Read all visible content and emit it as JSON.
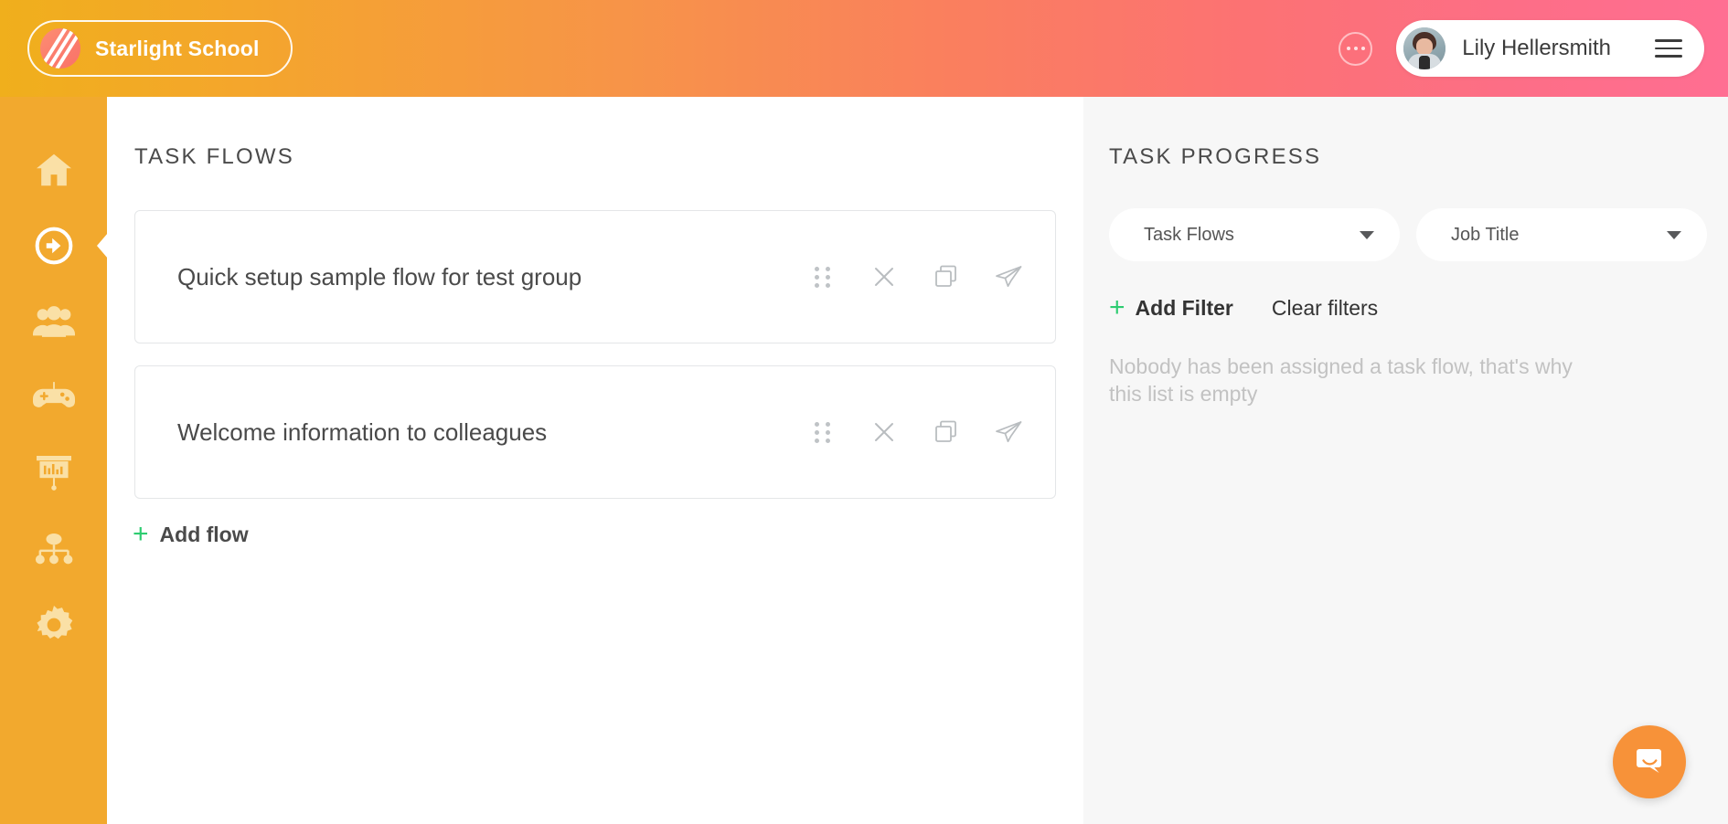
{
  "header": {
    "brand": {
      "name": "Starlight School",
      "logo_icon": "diagonal-stripes-logo"
    },
    "more_icon": "ellipsis-icon",
    "user": {
      "name": "Lily Hellersmith",
      "avatar_icon": "user-avatar-photo"
    },
    "menu_icon": "hamburger-menu-icon",
    "gradient_start": "#F0AF1C",
    "gradient_end": "#FF6E92"
  },
  "sidebar": {
    "background": "#F2A92E",
    "items": [
      {
        "name": "home",
        "icon": "home-icon",
        "active": false
      },
      {
        "name": "onboarding",
        "icon": "arrow-right-circle-icon",
        "active": true
      },
      {
        "name": "people",
        "icon": "people-group-icon",
        "active": false
      },
      {
        "name": "gamification",
        "icon": "gamepad-icon",
        "active": false
      },
      {
        "name": "presentations",
        "icon": "presentation-board-icon",
        "active": false
      },
      {
        "name": "org-chart",
        "icon": "hierarchy-icon",
        "active": false
      },
      {
        "name": "settings",
        "icon": "gear-icon",
        "active": false
      }
    ]
  },
  "main": {
    "title": "TASK FLOWS",
    "flows": [
      {
        "title": "Quick setup sample flow for test group",
        "actions": [
          "drag-handle-icon",
          "close-icon",
          "duplicate-icon",
          "send-icon"
        ]
      },
      {
        "title": "Welcome information to colleagues",
        "actions": [
          "drag-handle-icon",
          "close-icon",
          "duplicate-icon",
          "send-icon"
        ]
      }
    ],
    "add_flow": {
      "plus": "+",
      "label": "Add flow",
      "accent": "#2ECC71"
    }
  },
  "right_panel": {
    "title": "TASK PROGRESS",
    "background": "#F7F7F7",
    "dropdowns": [
      {
        "name": "task-flows",
        "value": "Task Flows"
      },
      {
        "name": "job-title",
        "value": "Job Title"
      }
    ],
    "add_filter": {
      "plus": "+",
      "label": "Add Filter",
      "accent": "#2ECC71"
    },
    "clear_filters_label": "Clear filters",
    "empty_message": "Nobody has been assigned a task flow, that's why this list is empty"
  },
  "launcher": {
    "icon": "chat-bubble-smile-icon",
    "color": "#F79239"
  }
}
